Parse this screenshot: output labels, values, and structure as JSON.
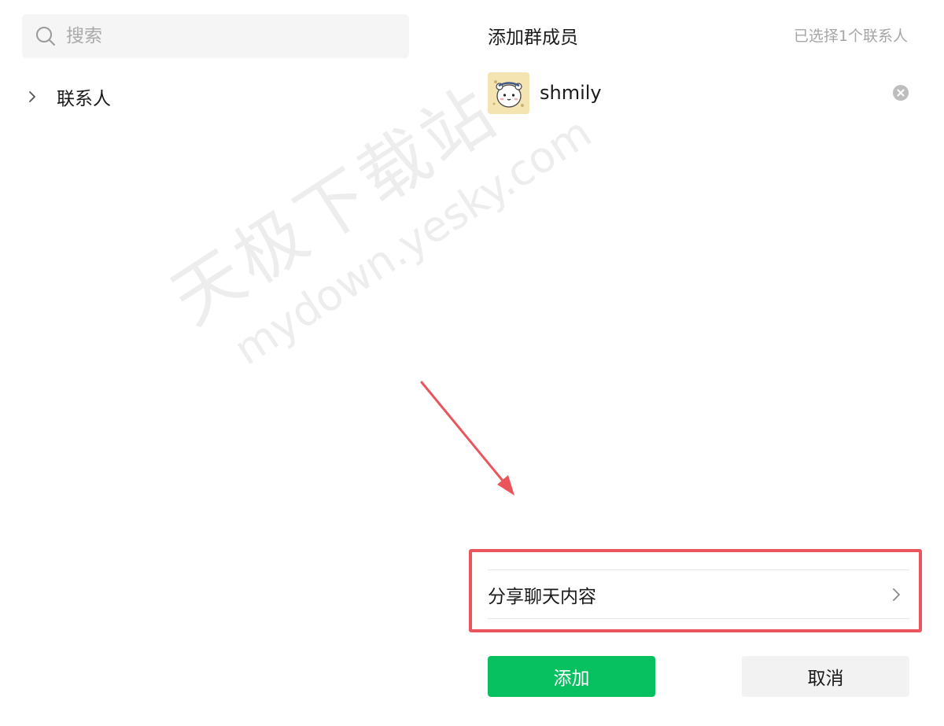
{
  "search": {
    "placeholder": "搜索"
  },
  "contacts_tree": {
    "label": "联系人"
  },
  "panel": {
    "title": "添加群成员",
    "selected_count": "已选择1个联系人"
  },
  "selected_members": [
    {
      "name": "shmily"
    }
  ],
  "share_option": {
    "label": "分享聊天内容"
  },
  "buttons": {
    "add": "添加",
    "cancel": "取消"
  },
  "watermark": {
    "cn": "天极下载站",
    "en": "mydown.yesky.com"
  },
  "colors": {
    "accent_green": "#07c160",
    "highlight_red": "#e9545d",
    "muted_text": "#a6a6a6"
  }
}
